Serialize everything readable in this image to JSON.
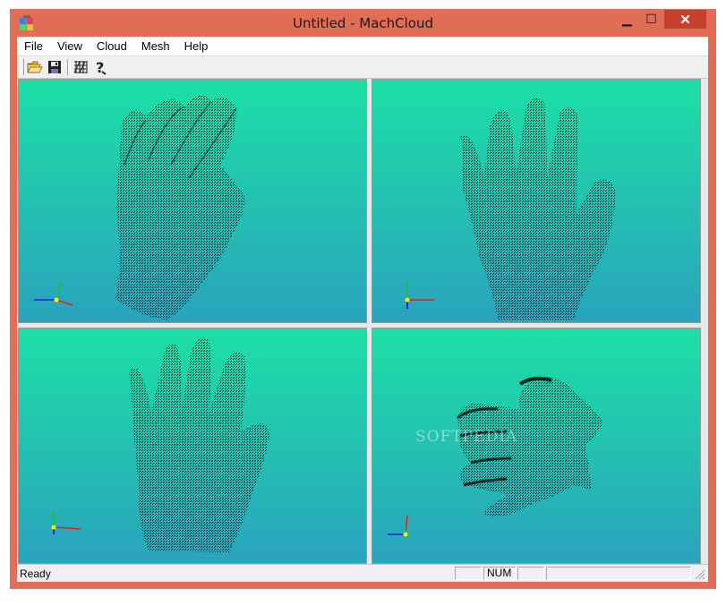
{
  "window": {
    "title": "Untitled - MachCloud",
    "minimize_glyph": "▁",
    "maximize_glyph": "☐",
    "close_glyph": "✕"
  },
  "menu": [
    "File",
    "View",
    "Cloud",
    "Mesh",
    "Help"
  ],
  "toolbar": {
    "buttons": [
      "open-folder-icon",
      "save-icon",
      "mesh-icon",
      "help-icon"
    ]
  },
  "viewports": [
    {
      "name": "viewport-top-left",
      "content": "hand point cloud - perspective view"
    },
    {
      "name": "viewport-top-right",
      "content": "hand point cloud - front view"
    },
    {
      "name": "viewport-bottom-left",
      "content": "hand point cloud - back view"
    },
    {
      "name": "viewport-bottom-right",
      "content": "hand point cloud - top view"
    }
  ],
  "colors": {
    "viewport_top": "#1ddfa6",
    "viewport_bottom": "#2aa3bd",
    "window_frame": "#e26d56",
    "axis_x": "#e02020",
    "axis_y": "#20c020",
    "axis_z": "#2020e0",
    "axis_origin": "#ffee00"
  },
  "statusbar": {
    "text": "Ready",
    "num": "NUM"
  },
  "watermark": "SOFTPEDIA"
}
